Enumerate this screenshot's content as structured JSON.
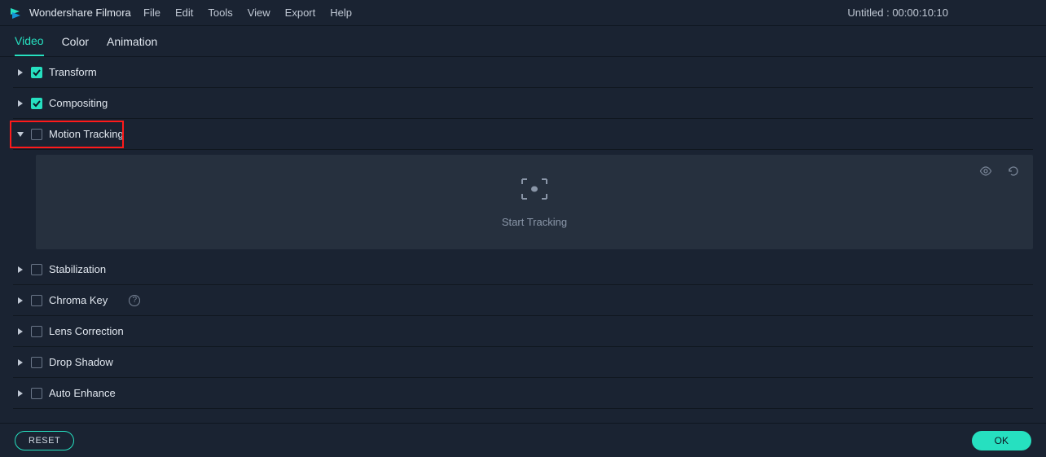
{
  "app": {
    "title": "Wondershare Filmora",
    "project_title": "Untitled : 00:00:10:10"
  },
  "menu": {
    "file": "File",
    "edit": "Edit",
    "tools": "Tools",
    "view": "View",
    "export": "Export",
    "help": "Help"
  },
  "tabs": {
    "video": "Video",
    "color": "Color",
    "animation": "Animation"
  },
  "sections": {
    "transform": "Transform",
    "compositing": "Compositing",
    "motion_tracking": "Motion Tracking",
    "stabilization": "Stabilization",
    "chroma_key": "Chroma Key",
    "lens_correction": "Lens Correction",
    "drop_shadow": "Drop Shadow",
    "auto_enhance": "Auto Enhance"
  },
  "tracking": {
    "start_label": "Start Tracking"
  },
  "footer": {
    "reset": "RESET",
    "ok": "OK"
  }
}
